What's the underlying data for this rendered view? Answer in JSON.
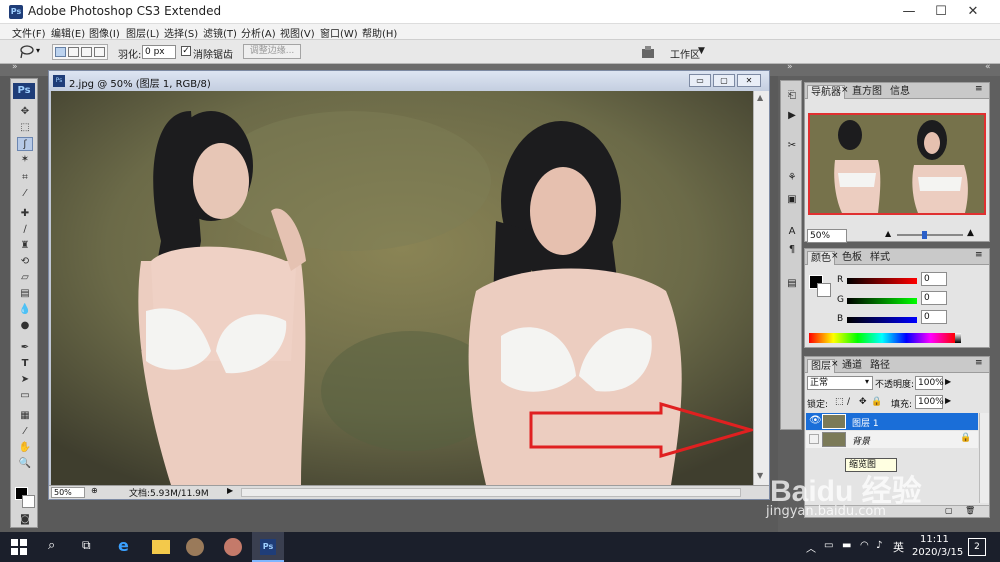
{
  "app": {
    "title": "Adobe Photoshop CS3 Extended",
    "logo_text": "Ps",
    "window_controls": {
      "minimize": "—",
      "maximize": "☐",
      "close": "✕"
    }
  },
  "menu": [
    "文件(F)",
    "编辑(E)",
    "图像(I)",
    "图层(L)",
    "选择(S)",
    "滤镜(T)",
    "分析(A)",
    "视图(V)",
    "窗口(W)",
    "帮助(H)"
  ],
  "options": {
    "feather_label": "羽化:",
    "feather_value": "0 px",
    "antialias_label": "消除锯齿",
    "antialias_checked": true,
    "refine_edge_label": "调整边缘...",
    "workspace_label": "工作区"
  },
  "toolbox": {
    "header": "Ps"
  },
  "document": {
    "title": "2.jpg @ 50% (图层 1, RGB/8)",
    "zoom": "50%",
    "doc_info": "文档:5.93M/11.9M"
  },
  "navigator": {
    "tabs": [
      "导航器",
      "直方图",
      "信息"
    ],
    "zoom": "50%"
  },
  "color": {
    "tabs": [
      "颜色",
      "色板",
      "样式"
    ],
    "channels": [
      {
        "label": "R",
        "value": "0"
      },
      {
        "label": "G",
        "value": "0"
      },
      {
        "label": "B",
        "value": "0"
      }
    ]
  },
  "layers": {
    "tabs": [
      "图层",
      "通道",
      "路径"
    ],
    "blend_mode": "正常",
    "opacity_label": "不透明度:",
    "opacity": "100%",
    "lock_label": "锁定:",
    "fill_label": "填充:",
    "fill": "100%",
    "items": [
      {
        "name": "图层 1",
        "selected": true,
        "visible": true
      },
      {
        "name": "背景",
        "selected": false,
        "visible": false
      }
    ],
    "tooltip": "缩览图"
  },
  "watermark": {
    "text": "Baidu 经验",
    "url": "jingyan.baidu.com"
  },
  "taskbar": {
    "time": "11:11",
    "date": "2020/3/15",
    "ime": "英",
    "notification_count": "2"
  },
  "colors": {
    "accent": "#1a6ed8",
    "arrow": "#e02020"
  }
}
